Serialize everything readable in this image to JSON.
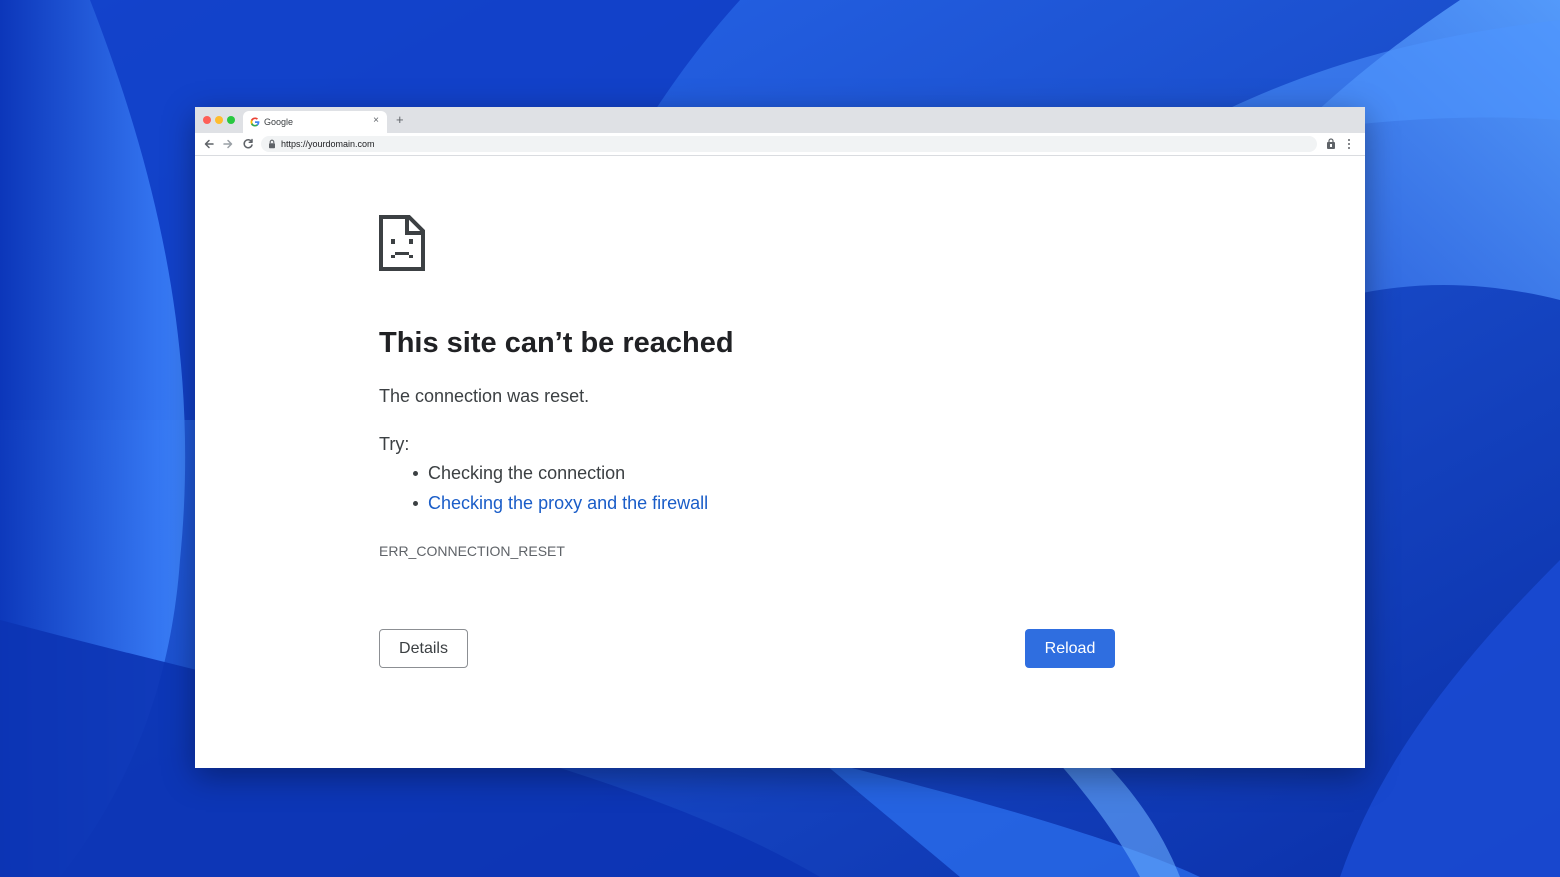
{
  "colors": {
    "wallpaper_base": "#1d4fd8",
    "link": "#1a5dc8",
    "primary_button": "#2f6ee0"
  },
  "browser": {
    "tab": {
      "title": "Google",
      "favicon": "google-g-icon",
      "close_glyph": "×"
    },
    "new_tab_glyph": "+",
    "address_bar": {
      "url": "https://yourdomain.com",
      "security_icon": "lock-icon"
    },
    "toolbar_icons": [
      "back-arrow-icon",
      "forward-arrow-icon",
      "reload-icon",
      "extension-icon",
      "menu-dots-icon"
    ]
  },
  "error_page": {
    "icon": "sad-page-icon",
    "heading": "This site can’t be reached",
    "message": "The connection was reset.",
    "try_label": "Try:",
    "suggestions": [
      {
        "text": "Checking the connection",
        "is_link": false
      },
      {
        "text": "Checking the proxy and the firewall",
        "is_link": true
      }
    ],
    "error_code": "ERR_CONNECTION_RESET",
    "details_button": "Details",
    "reload_button": "Reload"
  }
}
